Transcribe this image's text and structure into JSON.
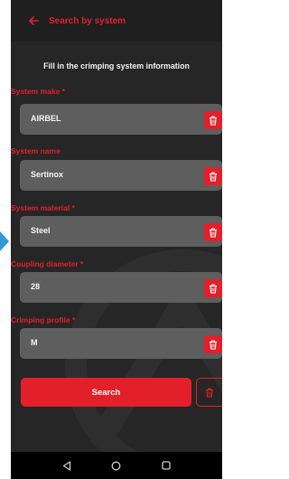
{
  "header": {
    "title": "Search by system",
    "back_icon": "back-arrow-icon"
  },
  "intro": "Fill in the crimping system information",
  "fields": [
    {
      "label": "System make *",
      "value": "AIRBEL",
      "icon": "trash-icon"
    },
    {
      "label": "System name",
      "value": "Sertinox",
      "icon": "trash-icon"
    },
    {
      "label": "System material *",
      "value": "Steel",
      "icon": "trash-icon"
    },
    {
      "label": "Coupling diameter *",
      "value": "28",
      "icon": "trash-icon"
    },
    {
      "label": "Crimping profile *",
      "value": "M",
      "icon": "trash-icon"
    }
  ],
  "actions": {
    "search_label": "Search",
    "reset_icon": "trash-icon"
  },
  "navbar": {
    "back": "nav-back-icon",
    "home": "nav-home-icon",
    "recents": "nav-recents-icon"
  },
  "colors": {
    "accent": "#e3202a",
    "background": "#262626",
    "field": "#5e5e5e",
    "side_arrow": "#2f9ad6"
  }
}
